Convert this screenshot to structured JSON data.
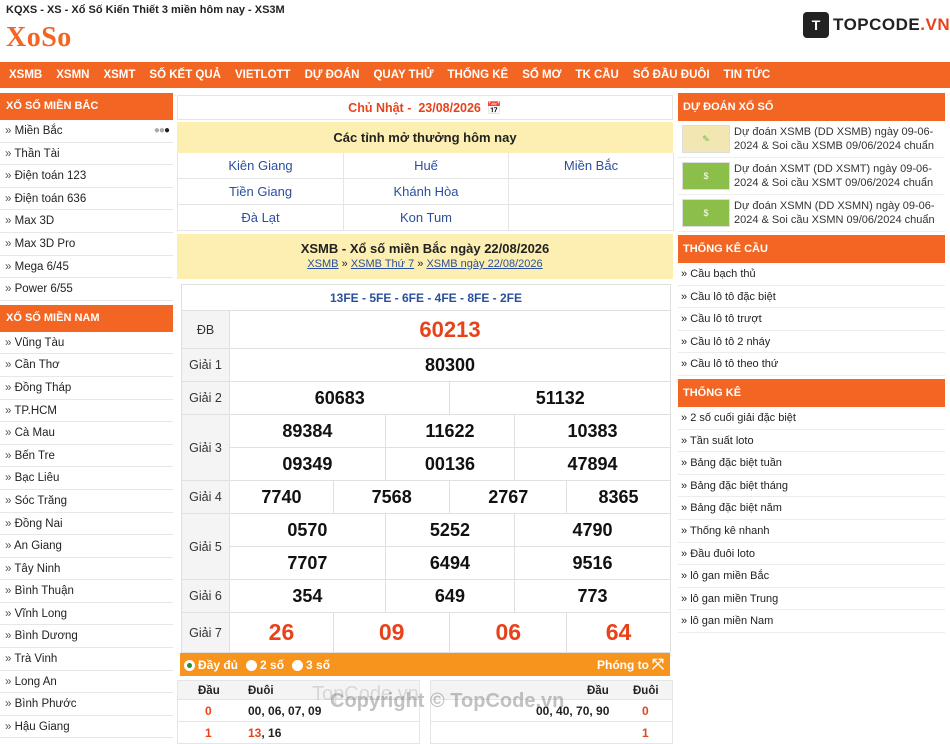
{
  "page_title": "KQXS - XS - Xổ Số Kiến Thiết 3 miền hôm nay - XS3M",
  "logo": "XoSo",
  "brand": {
    "icon": "T",
    "name_main": "TOPCODE",
    "name_suffix": ".VN"
  },
  "nav": [
    "XSMB",
    "XSMN",
    "XSMT",
    "SỐ KẾT QUẢ",
    "VIETLOTT",
    "DỰ ĐOÁN",
    "QUAY THỬ",
    "THỐNG KÊ",
    "SỔ MƠ",
    "TK CẦU",
    "SỐ ĐẦU ĐUÔI",
    "TIN TỨC"
  ],
  "left": {
    "north_title": "XỔ SỐ MIỀN BẮC",
    "north_items": [
      "Miền Bắc",
      "Thần Tài",
      "Điện toán 123",
      "Điện toán 636",
      "Max 3D",
      "Max 3D Pro",
      "Mega 6/45",
      "Power 6/55"
    ],
    "south_title": "XỔ SỐ MIỀN NAM",
    "south_items": [
      "Vũng Tàu",
      "Cần Thơ",
      "Đồng Tháp",
      "TP.HCM",
      "Cà Mau",
      "Bến Tre",
      "Bạc Liêu",
      "Sóc Trăng",
      "Đồng Nai",
      "An Giang",
      "Tây Ninh",
      "Bình Thuận",
      "Vĩnh Long",
      "Bình Dương",
      "Trà Vinh",
      "Long An",
      "Bình Phước",
      "Hậu Giang"
    ]
  },
  "center": {
    "day_label": "Chủ Nhật -",
    "date": "23/08/2026",
    "provinces_title": "Các tỉnh mở thưởng hôm nay",
    "provinces": [
      "Kiên Giang",
      "Huế",
      "Miền Bắc",
      "Tiền Giang",
      "Khánh Hòa",
      "",
      "Đà Lạt",
      "Kon Tum",
      ""
    ],
    "result_title": "XSMB - Xổ số miền Bắc ngày 22/08/2026",
    "crumb": {
      "a": "XSMB",
      "sep": "»",
      "b": "XSMB Thứ 7",
      "c": "XSMB ngày 22/08/2026"
    },
    "codes": "13FE - 5FE - 6FE - 4FE - 8FE - 2FE",
    "labels": {
      "db": "ĐB",
      "g1": "Giải 1",
      "g2": "Giải 2",
      "g3": "Giải 3",
      "g4": "Giải 4",
      "g5": "Giải 5",
      "g6": "Giải 6",
      "g7": "Giải 7"
    },
    "prizes": {
      "db": "60213",
      "g1": "80300",
      "g2": [
        "60683",
        "51132"
      ],
      "g3": [
        "89384",
        "11622",
        "10383",
        "09349",
        "00136",
        "47894"
      ],
      "g4": [
        "7740",
        "7568",
        "2767",
        "8365"
      ],
      "g5": [
        "0570",
        "5252",
        "4790",
        "7707",
        "6494",
        "9516"
      ],
      "g6": [
        "354",
        "649",
        "773"
      ],
      "g7": [
        "26",
        "09",
        "06",
        "64"
      ]
    },
    "options": {
      "full": "Đầy đủ",
      "two": "2 số",
      "three": "3 số",
      "zoom": "Phóng to"
    },
    "loto": {
      "left_head": [
        "Đầu",
        "Đuôi"
      ],
      "left_rows": [
        {
          "k": "0",
          "v": "00, 06, 07, 09"
        },
        {
          "k": "1",
          "v_hl": "13",
          "v": ", 16"
        }
      ],
      "right_head": [
        "Đầu",
        "Đuôi"
      ],
      "right_rows": [
        {
          "v": "00, 40, 70, 90",
          "k": "0"
        },
        {
          "v": "",
          "k": "1"
        }
      ]
    }
  },
  "right": {
    "pred_title": "DỰ ĐOÁN XỔ SỐ",
    "predictions": [
      "Dự đoán XSMB (DD XSMB) ngày 09-06-2024 & Soi cầu XSMB 09/06/2024 chuẩn",
      "Dự đoán XSMT (DD XSMT) ngày 09-06-2024 & Soi cầu XSMT 09/06/2024 chuẩn",
      "Dự đoán XSMN (DD XSMN) ngày 09-06-2024 & Soi cầu XSMN 09/06/2024 chuẩn"
    ],
    "cau_title": "THỐNG KÊ CẦU",
    "cau_items": [
      "Cầu bạch thủ",
      "Cầu lô tô đặc biệt",
      "Cầu lô tô trượt",
      "Cầu lô tô 2 nháy",
      "Cầu lô tô theo thứ"
    ],
    "tk_title": "THỐNG KÊ",
    "tk_items": [
      "2 số cuối giải đặc biệt",
      "Tần suất loto",
      "Bảng đặc biệt tuần",
      "Bảng đặc biệt tháng",
      "Bảng đặc biệt năm",
      "Thống kê nhanh",
      "Đầu đuôi loto",
      "lô gan miền Bắc",
      "lô gan miền Trung",
      "lô gan miền Nam"
    ]
  },
  "watermark": "Copyright © TopCode.vn",
  "watermark2": "TopCode.vn",
  "arrow": "»",
  "colors": {
    "accent": "#f26522",
    "highlight": "#e8421b",
    "link": "#2a4f9c",
    "yellow": "#fdefb2"
  }
}
